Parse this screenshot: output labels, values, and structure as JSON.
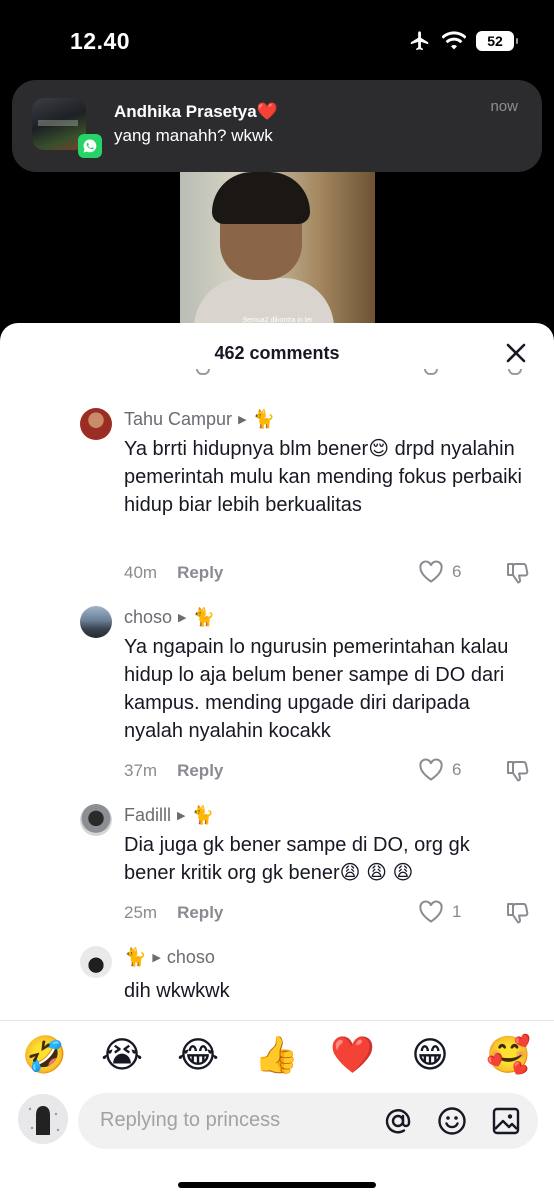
{
  "status_bar": {
    "time": "12.40",
    "battery": "52"
  },
  "notification": {
    "sender": "Andhika Prasetya",
    "sender_emoji": "❤️",
    "message": "yang manahh? wkwk",
    "time": "now"
  },
  "video": {
    "caption": "Semua2 dikontra in ler"
  },
  "sheet": {
    "title": "462 comments"
  },
  "comments": [
    {
      "username": "Tahu Campur",
      "emoji": "🐈",
      "text": "Ya brrti hidupnya blm bener😌 drpd nyalahin pemerintah mulu kan mending fokus perbaiki hidup biar lebih berkualitas",
      "time": "40m",
      "reply_label": "Reply",
      "likes": "6"
    },
    {
      "username": "choso",
      "emoji": "🐈",
      "text": "Ya ngapain lo ngurusin pemerintahan kalau hidup lo aja belum bener sampe di DO dari kampus. mending upgade diri daripada nyalah nyalahin kocakk",
      "time": "37m",
      "reply_label": "Reply",
      "likes": "6"
    },
    {
      "username": "Fadilll",
      "emoji": "🐈",
      "text": "Dia juga gk bener sampe di DO, org gk bener kritik org gk bener😩 😩 😩",
      "time": "25m",
      "reply_label": "Reply",
      "likes": "1"
    },
    {
      "username": "choso",
      "emoji": "🐈",
      "text": "dih wkwkwk"
    }
  ],
  "quick_emojis": [
    "🤣",
    "😭",
    "😂",
    "👍",
    "❤️",
    "😁",
    "🥰"
  ],
  "input": {
    "placeholder": "Replying to princess"
  },
  "icons": {
    "close": "close-icon",
    "like": "heart-icon",
    "dislike": "thumbs-down-icon",
    "mention": "at-icon",
    "emoji": "smiley-icon",
    "image": "image-icon"
  }
}
